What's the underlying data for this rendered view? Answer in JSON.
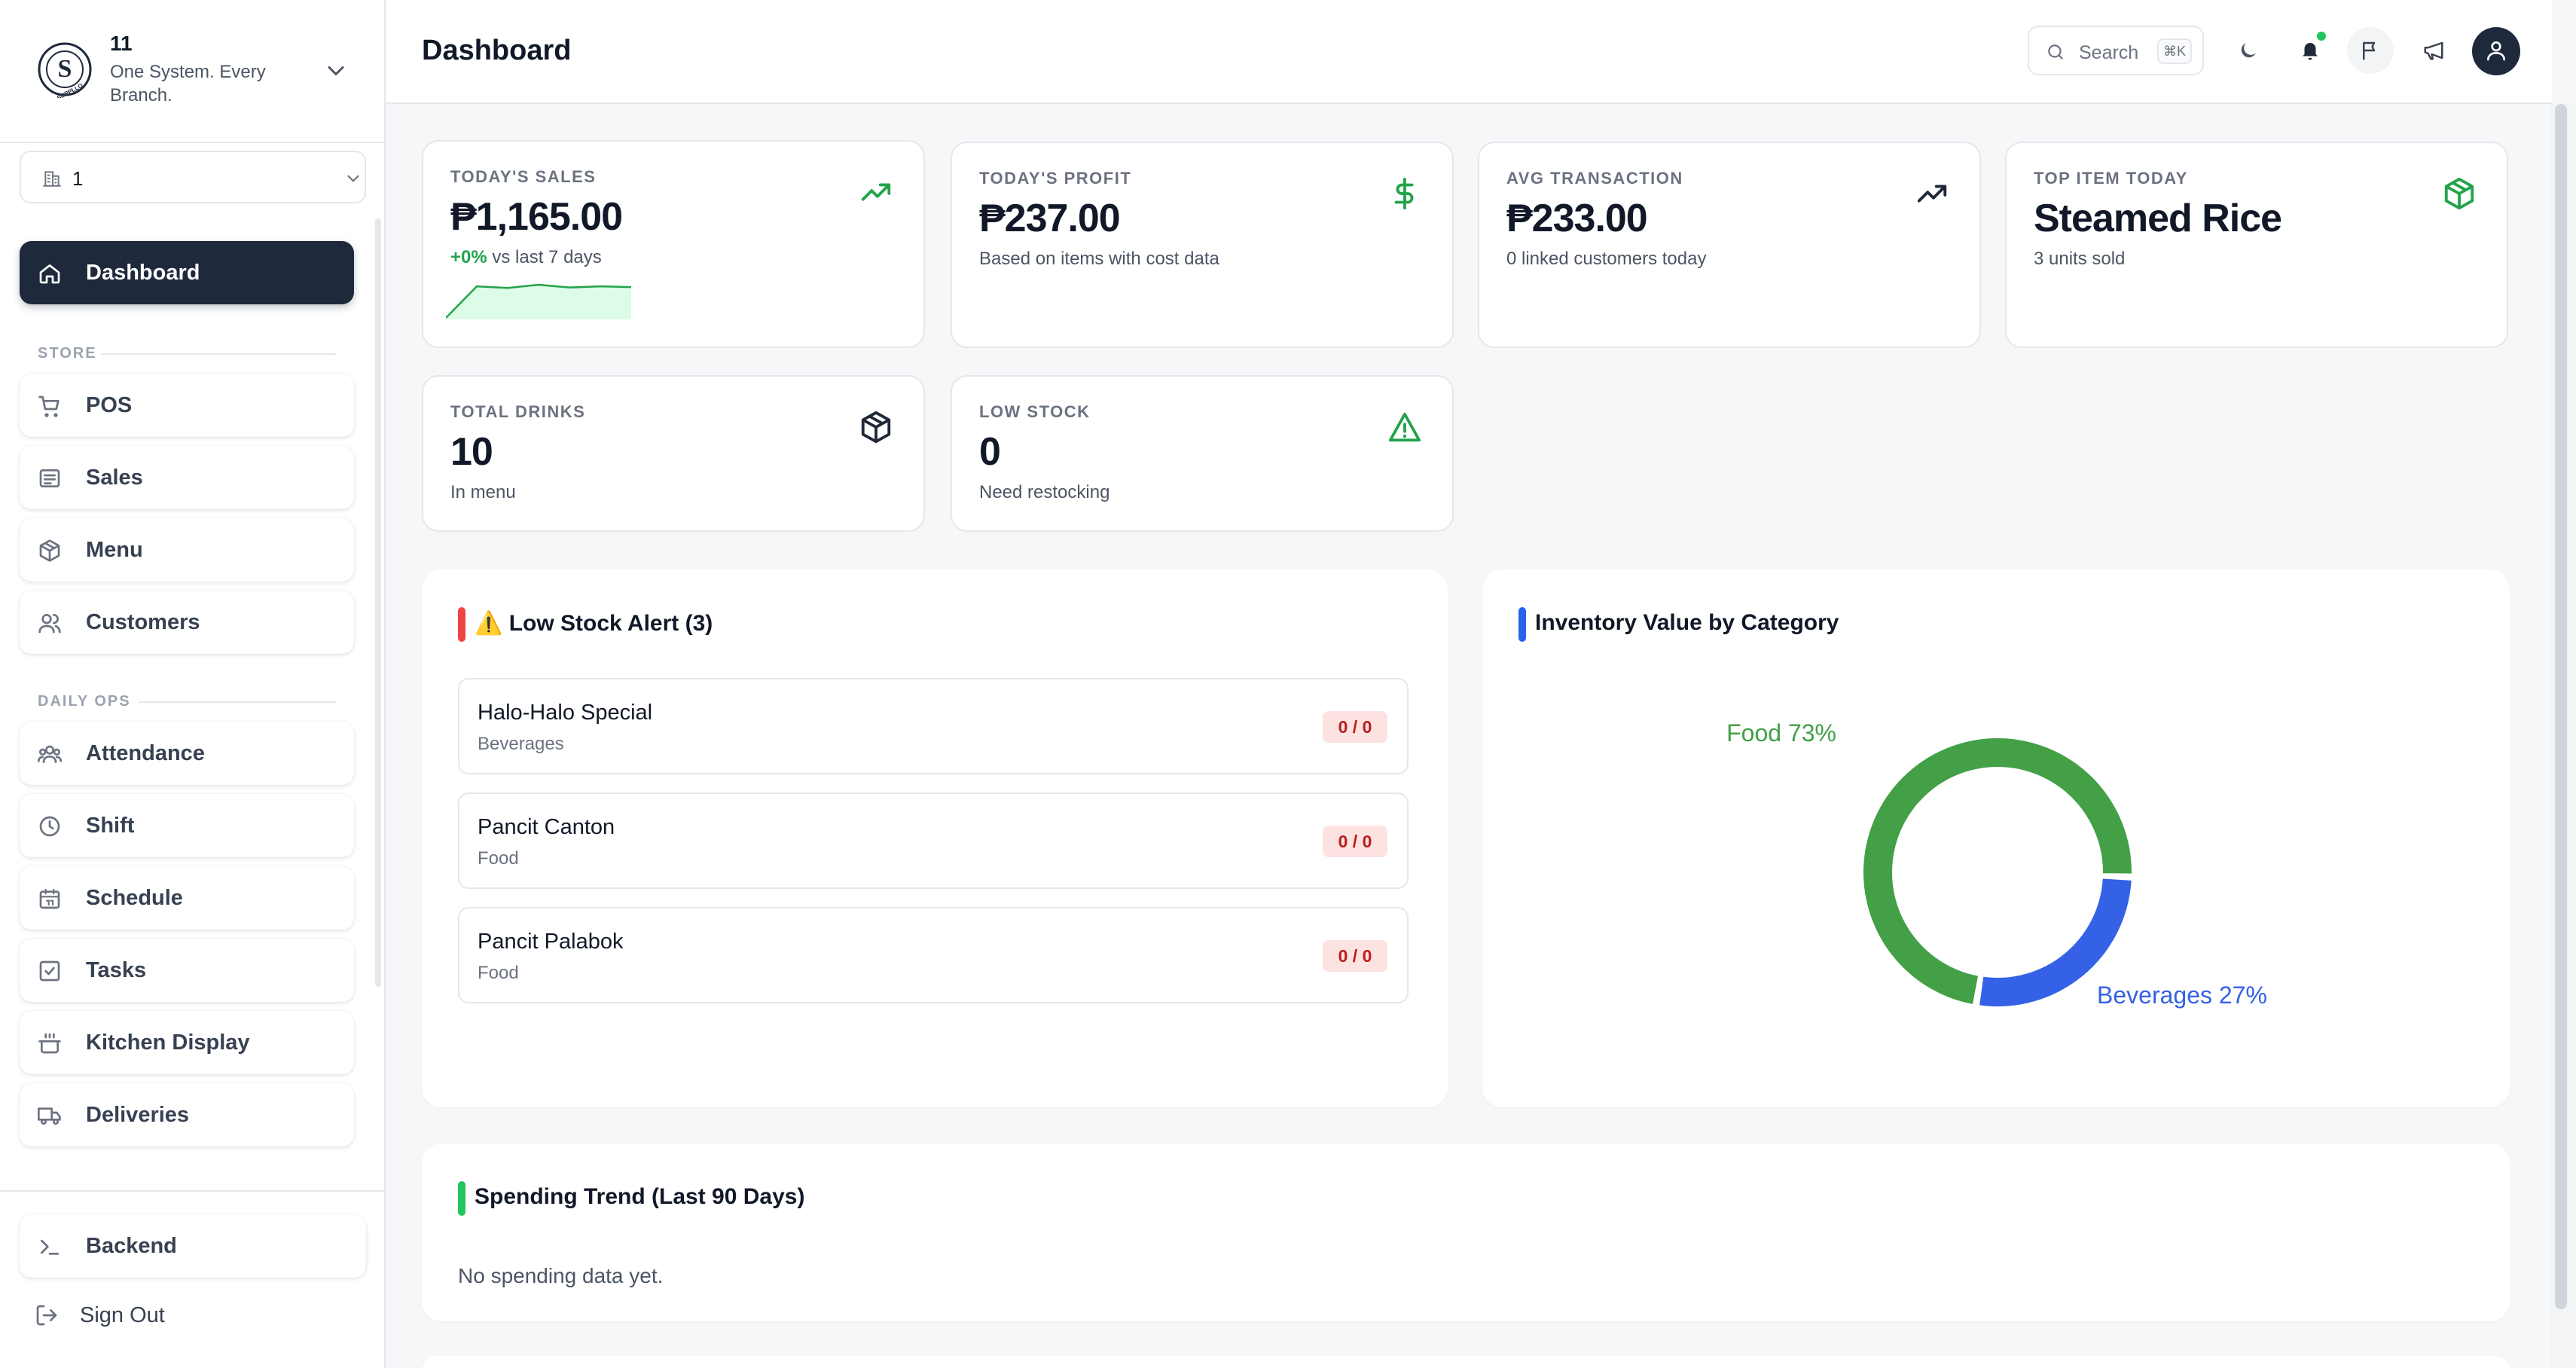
{
  "brand": {
    "name": "11",
    "tagline": "One System. Every Branch.",
    "logo_letter": "S",
    "logo_ring_text": "SUPPLLO"
  },
  "branch": {
    "value": "1"
  },
  "sidebar": {
    "dashboard": "Dashboard",
    "store_label": "STORE",
    "store": [
      "POS",
      "Sales",
      "Menu",
      "Customers"
    ],
    "daily_label": "DAILY OPS",
    "daily": [
      "Attendance",
      "Shift",
      "Schedule",
      "Tasks",
      "Kitchen Display",
      "Deliveries"
    ],
    "backend": "Backend",
    "signout": "Sign Out"
  },
  "header": {
    "title": "Dashboard",
    "search_label": "Search",
    "search_shortcut": "⌘K"
  },
  "stats": [
    {
      "label": "TODAY'S SALES",
      "value": "₱1,165.00",
      "delta": "+0%",
      "sub": "vs last 7 days",
      "icon": "trending-up-icon",
      "icon_color": "#22a34a"
    },
    {
      "label": "TODAY'S PROFIT",
      "value": "₱237.00",
      "sub": "Based on items with cost data",
      "icon": "dollar-icon",
      "icon_color": "#22a34a"
    },
    {
      "label": "AVG TRANSACTION",
      "value": "₱233.00",
      "sub": "0 linked customers today",
      "icon": "trending-up-icon",
      "icon_color": "#1f2937"
    },
    {
      "label": "TOP ITEM TODAY",
      "value": "Steamed Rice",
      "sub": "3 units sold",
      "icon": "package-icon",
      "icon_color": "#22a34a"
    },
    {
      "label": "TOTAL DRINKS",
      "value": "10",
      "sub": "In menu",
      "icon": "package-icon",
      "icon_color": "#1f2937"
    },
    {
      "label": "LOW STOCK",
      "value": "0",
      "sub": "Need restocking",
      "icon": "warning-icon",
      "icon_color": "#22a34a"
    }
  ],
  "sales_sparkline": [
    0,
    8,
    7.6,
    8.4,
    7.7,
    8,
    7.8
  ],
  "low_stock": {
    "title": "⚠️ Low Stock Alert (3)",
    "accent": "#ef4444",
    "items": [
      {
        "name": "Halo-Halo Special",
        "category": "Beverages",
        "badge": "0 / 0"
      },
      {
        "name": "Pancit Canton",
        "category": "Food",
        "badge": "0 / 0"
      },
      {
        "name": "Pancit Palabok",
        "category": "Food",
        "badge": "0 / 0"
      }
    ]
  },
  "inventory": {
    "title": "Inventory Value by Category",
    "accent": "#2563eb",
    "labels": [
      "Food 73%",
      "Beverages 27%"
    ]
  },
  "chart_data": {
    "type": "pie",
    "title": "Inventory Value by Category",
    "categories": [
      "Food",
      "Beverages"
    ],
    "values": [
      73,
      27
    ],
    "colors": [
      "#43a047",
      "#3461e6"
    ],
    "donut": true
  },
  "spending": {
    "title": "Spending Trend (Last 90 Days)",
    "accent": "#22c55e",
    "empty": "No spending data yet."
  }
}
